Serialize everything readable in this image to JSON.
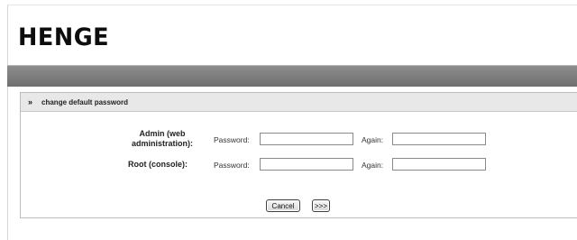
{
  "brand": {
    "logo_text": "HENGE"
  },
  "section": {
    "title": "change default password",
    "expand_icon": "double-chevron-right-icon"
  },
  "rows": [
    {
      "label": "Admin (web administration):",
      "password_label": "Password:",
      "again_label": "Again:",
      "password_value": "",
      "again_value": ""
    },
    {
      "label": "Root (console):",
      "password_label": "Password:",
      "again_label": "Again:",
      "password_value": "",
      "again_value": ""
    }
  ],
  "buttons": {
    "cancel": "Cancel",
    "next": ">>>"
  }
}
